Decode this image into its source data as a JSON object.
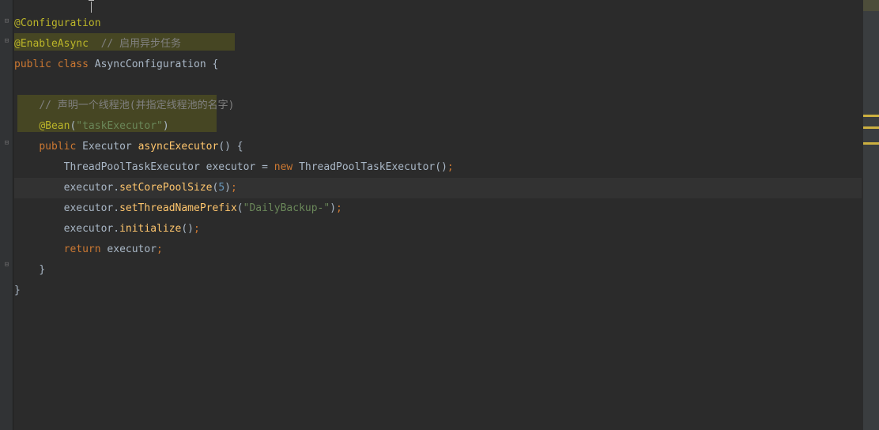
{
  "code": {
    "ann_config": "@Configuration",
    "ann_enableasync": "@EnableAsync",
    "cmt_enableasync": "  // 启用异步任务",
    "kw_public1": "public",
    "kw_class": "class",
    "cls_name": "AsyncConfiguration",
    "brace_open": " {",
    "cmt_pool": "// 声明一个线程池(并指定线程池的名字)",
    "ann_bean": "@Bean",
    "paren_open": "(",
    "str_taskexec": "\"taskExecutor\"",
    "paren_close": ")",
    "kw_public2": "public",
    "type_executor": "Executor",
    "m_asyncexec": "asyncExecutor",
    "paren_empty": "()",
    "brace_open2": " {",
    "type_tpte": "ThreadPoolTaskExecutor",
    "var_exec": "executor",
    "eq": " = ",
    "kw_new": "new",
    "m_ctor": "ThreadPoolTaskExecutor",
    "paren_empty2": "()",
    "semi": ";",
    "l6_exec": "executor.",
    "m_setcore": "setCorePoolSize",
    "num_5": "5",
    "l7_exec": "executor.",
    "m_setprefix": "setThreadNamePrefix",
    "str_daily": "\"DailyBackup-\"",
    "l8_exec": "executor.",
    "m_init": "initialize",
    "kw_return": "return",
    "var_exec2": " executor",
    "brace_close": "}",
    "brace_close2": "}"
  },
  "space": " ",
  "indent1": "    ",
  "indent2": "        "
}
